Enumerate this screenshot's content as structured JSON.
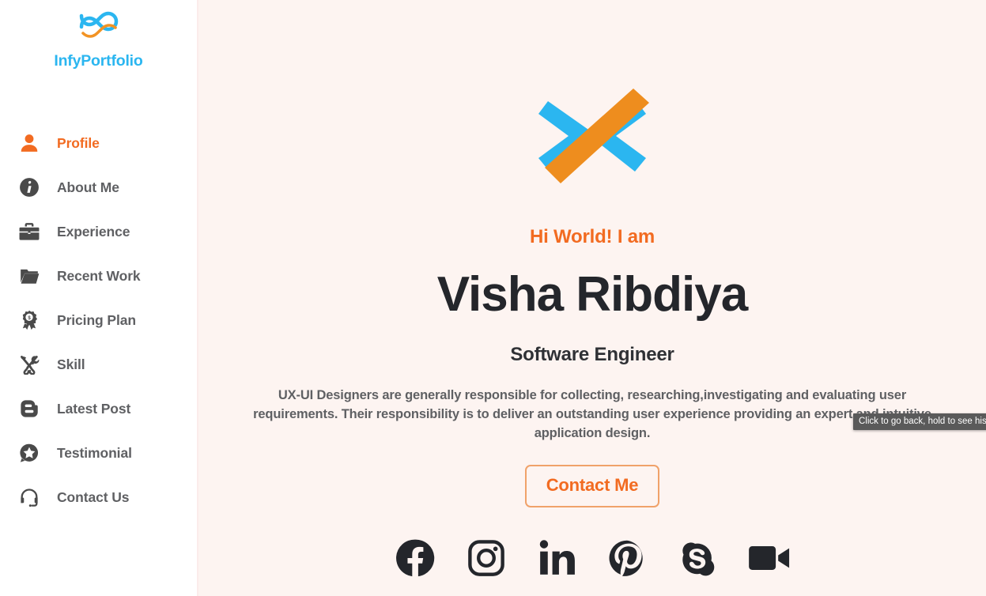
{
  "sidebar": {
    "brand": {
      "logo_icon": "infinity-icon",
      "name": "InfyPortfolio",
      "color": "#2bb6f0"
    },
    "items": [
      {
        "label": "Profile",
        "icon": "user-icon",
        "active": true
      },
      {
        "label": "About Me",
        "icon": "info-circle-icon",
        "active": false
      },
      {
        "label": "Experience",
        "icon": "briefcase-icon",
        "active": false
      },
      {
        "label": "Recent Work",
        "icon": "folder-icon",
        "active": false
      },
      {
        "label": "Pricing Plan",
        "icon": "award-dollar-icon",
        "active": false
      },
      {
        "label": "Skill",
        "icon": "tools-icon",
        "active": false
      },
      {
        "label": "Latest Post",
        "icon": "blogger-icon",
        "active": false
      },
      {
        "label": "Testimonial",
        "icon": "star-chat-icon",
        "active": false
      },
      {
        "label": "Contact Us",
        "icon": "headset-icon",
        "active": false
      }
    ]
  },
  "main": {
    "hero_logo_icon": "x-mark-logo",
    "greeting": "Hi World! I am",
    "full_name": "Visha Ribdiya",
    "job_title": "Software Engineer",
    "bio": "UX-UI Designers are generally responsible for collecting, researching,investigating and evaluating user requirements. Their responsibility is to deliver an outstanding user experience providing an expert and intuitive application design.",
    "contact_button": "Contact Me",
    "socials": [
      {
        "name": "facebook-icon"
      },
      {
        "name": "instagram-icon"
      },
      {
        "name": "linkedin-icon"
      },
      {
        "name": "pinterest-icon"
      },
      {
        "name": "skype-icon"
      },
      {
        "name": "video-camera-icon"
      }
    ]
  },
  "overlay": {
    "back_tooltip": "Click to go back, hold to see history"
  },
  "colors": {
    "accent_orange": "#f26b21",
    "brand_blue": "#2bb6f0",
    "page_background": "#fdf4f1",
    "sidebar_background": "#ffffff",
    "text_dark": "#24262b",
    "text_muted": "#5f6063"
  }
}
